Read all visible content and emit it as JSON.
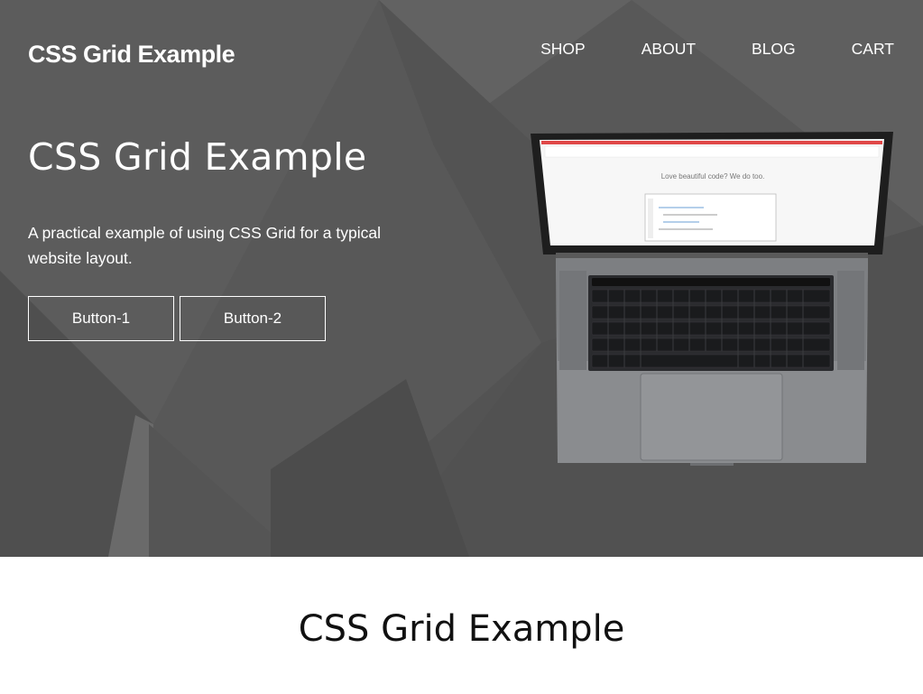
{
  "header": {
    "brand": "CSS Grid Example",
    "nav": [
      "SHOP",
      "ABOUT",
      "BLOG",
      "CART"
    ]
  },
  "hero": {
    "title": "CSS Grid Example",
    "text": "A practical example of using CSS Grid for a typical website layout.",
    "buttons": [
      "Button-1",
      "Button-2"
    ]
  },
  "laptop_screen": {
    "headline": "Love beautiful code? We do too."
  },
  "section": {
    "title": "CSS Grid Example"
  },
  "colors": {
    "hero_bg": "#585858",
    "text_light": "#ffffff",
    "section_bg": "#ffffff",
    "text_dark": "#111111"
  }
}
